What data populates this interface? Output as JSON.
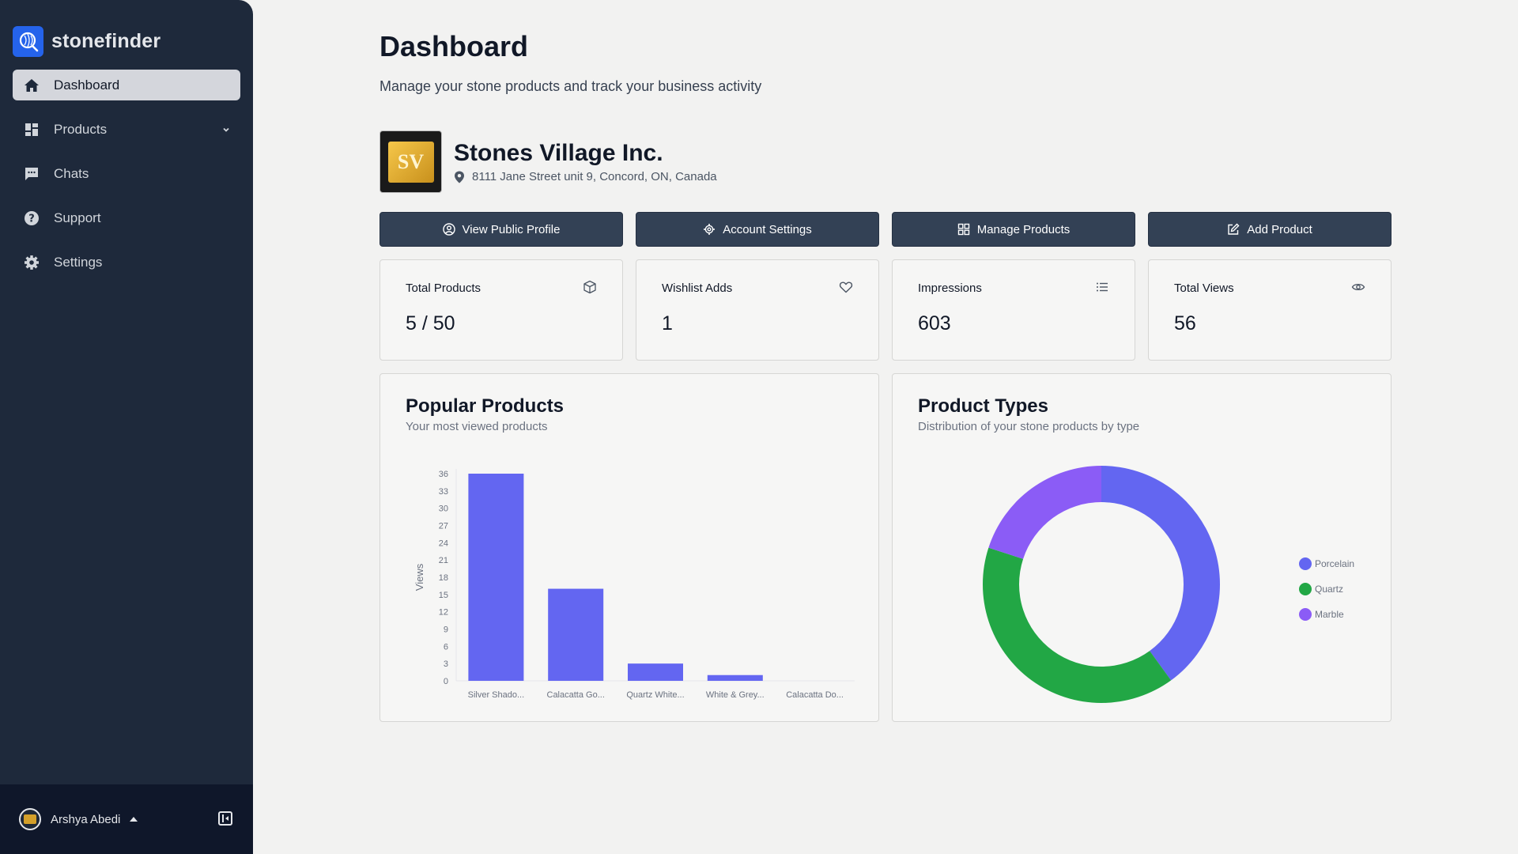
{
  "app": {
    "name": "stonefinder",
    "brand_color": "#2563eb"
  },
  "sidebar": {
    "items": [
      {
        "label": "Dashboard",
        "icon": "home-icon",
        "active": true
      },
      {
        "label": "Products",
        "icon": "grid-icon",
        "has_submenu": true
      },
      {
        "label": "Chats",
        "icon": "chat-icon"
      },
      {
        "label": "Support",
        "icon": "help-icon"
      },
      {
        "label": "Settings",
        "icon": "gear-icon"
      }
    ],
    "user": {
      "name": "Arshya Abedi"
    }
  },
  "page": {
    "title": "Dashboard",
    "subtitle": "Manage your stone products and track your business activity"
  },
  "company": {
    "name": "Stones Village Inc.",
    "address": "8111 Jane Street unit 9, Concord, ON, Canada",
    "logo_text": "SV"
  },
  "actions": [
    {
      "label": "View Public Profile",
      "icon": "user-circle-icon"
    },
    {
      "label": "Account Settings",
      "icon": "gear-icon"
    },
    {
      "label": "Manage Products",
      "icon": "grid-icon"
    },
    {
      "label": "Add Product",
      "icon": "edit-icon"
    }
  ],
  "stats": [
    {
      "label": "Total Products",
      "value": "5 / 50",
      "icon": "box-icon"
    },
    {
      "label": "Wishlist Adds",
      "value": "1",
      "icon": "heart-icon"
    },
    {
      "label": "Impressions",
      "value": "603",
      "icon": "list-icon"
    },
    {
      "label": "Total Views",
      "value": "56",
      "icon": "eye-icon"
    }
  ],
  "popular_panel": {
    "title": "Popular Products",
    "subtitle": "Your most viewed products"
  },
  "types_panel": {
    "title": "Product Types",
    "subtitle": "Distribution of your stone products by type"
  },
  "chart_data": [
    {
      "type": "bar",
      "title": "Popular Products",
      "ylabel": "Views",
      "categories": [
        "Silver Shado...",
        "Calacatta Go...",
        "Quartz White...",
        "White & Grey...",
        "Calacatta Do..."
      ],
      "values": [
        36,
        16,
        3,
        1,
        0
      ],
      "ylim": [
        0,
        36
      ],
      "yticks": [
        0,
        3,
        6,
        9,
        12,
        15,
        18,
        21,
        24,
        27,
        30,
        33,
        36
      ],
      "color": "#6366f1"
    },
    {
      "type": "pie",
      "title": "Product Types",
      "donut": true,
      "legend_position": "right",
      "categories": [
        "Porcelain",
        "Quartz",
        "Marble"
      ],
      "values": [
        2,
        2,
        1
      ],
      "colors": [
        "#6366f1",
        "#22a745",
        "#8b5cf6"
      ]
    }
  ]
}
